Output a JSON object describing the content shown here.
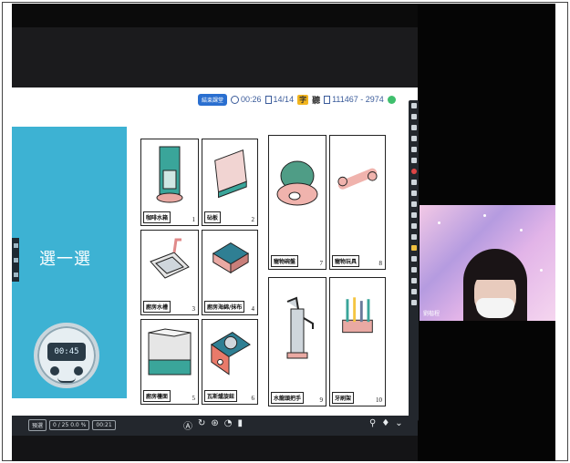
{
  "status_bar": {
    "pill": "結束課堂",
    "timer": "00:26",
    "pages": "14/14",
    "badge1": "字",
    "badge2": "聽",
    "points": "111467 - 2974"
  },
  "slide": {
    "title": "選一選",
    "clock_time": "00:45",
    "items": [
      {
        "label": "咖啡水箱",
        "num": "1"
      },
      {
        "label": "砧板",
        "num": "2"
      },
      {
        "label": "廚房水槽",
        "num": "3"
      },
      {
        "label": "廚房海綿/抹布",
        "num": "4"
      },
      {
        "label": "廚房檯面",
        "num": "5"
      },
      {
        "label": "瓦斯爐旋鈕",
        "num": "6"
      },
      {
        "label": "寵物碗盤",
        "num": "7"
      },
      {
        "label": "寵物玩具",
        "num": "8"
      },
      {
        "label": "水龍頭把手",
        "num": "9"
      },
      {
        "label": "牙刷架",
        "num": "10"
      }
    ]
  },
  "controls": {
    "chip1": "預選",
    "chip2": "0 / 25 0.0 %",
    "chip3": "00:21"
  },
  "camera": {
    "name": "劉楷程"
  },
  "colors": {
    "panel_blue": "#3db2d3",
    "pill_blue": "#2a6fd0",
    "badge_yellow": "#f2b51e"
  }
}
